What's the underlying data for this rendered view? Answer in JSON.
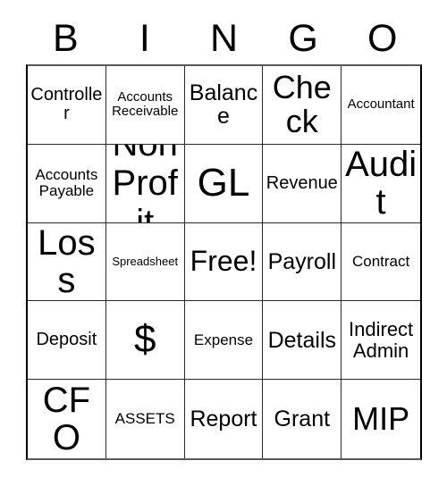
{
  "card": {
    "type": "bingo-card",
    "columns": 5,
    "rows": 5,
    "header_letters": [
      "B",
      "I",
      "N",
      "G",
      "O"
    ],
    "colors": {
      "background": "#ffffff",
      "text": "#000000",
      "grid_line": "#2b2b2b",
      "border": "#000000"
    },
    "cells": [
      [
        {
          "text": "Controller",
          "size": "ms",
          "lines": 1
        },
        {
          "text": "Accounts Receivable",
          "size": "xs",
          "lines": 2
        },
        {
          "text": "Balance",
          "size": "ml",
          "lines": 1
        },
        {
          "text": "Check",
          "size": "xxl",
          "lines": 1
        },
        {
          "text": "Accountant",
          "size": "xs",
          "lines": 1
        }
      ],
      [
        {
          "text": "Accounts Payable",
          "size": "s",
          "lines": 2
        },
        {
          "text": "Non Profit",
          "size": "xxxl",
          "lines": 2
        },
        {
          "text": "GL",
          "size": "huge",
          "lines": 1
        },
        {
          "text": "Revenue",
          "size": "ms",
          "lines": 1
        },
        {
          "text": "Audit",
          "size": "xxxl",
          "lines": 1
        }
      ],
      [
        {
          "text": "Loss",
          "size": "xxxl",
          "lines": 1
        },
        {
          "text": "Spreadsheet",
          "size": "xxs",
          "lines": 1
        },
        {
          "text": "Free!",
          "size": "xl",
          "lines": 1
        },
        {
          "text": "Payroll",
          "size": "ml",
          "lines": 1
        },
        {
          "text": "Contract",
          "size": "s",
          "lines": 1
        }
      ],
      [
        {
          "text": "Deposit",
          "size": "ms",
          "lines": 1
        },
        {
          "text": "$",
          "size": "huge",
          "lines": 1
        },
        {
          "text": "Expense",
          "size": "s",
          "lines": 1
        },
        {
          "text": "Details",
          "size": "ml",
          "lines": 1
        },
        {
          "text": "Indirect Admin",
          "size": "m",
          "lines": 2
        }
      ],
      [
        {
          "text": "CFO",
          "size": "xxxl",
          "lines": 1
        },
        {
          "text": "ASSETS",
          "size": "s",
          "lines": 1
        },
        {
          "text": "Report",
          "size": "ml",
          "lines": 1
        },
        {
          "text": "Grant",
          "size": "ml",
          "lines": 1
        },
        {
          "text": "MIP",
          "size": "xxl",
          "lines": 1
        }
      ]
    ]
  }
}
